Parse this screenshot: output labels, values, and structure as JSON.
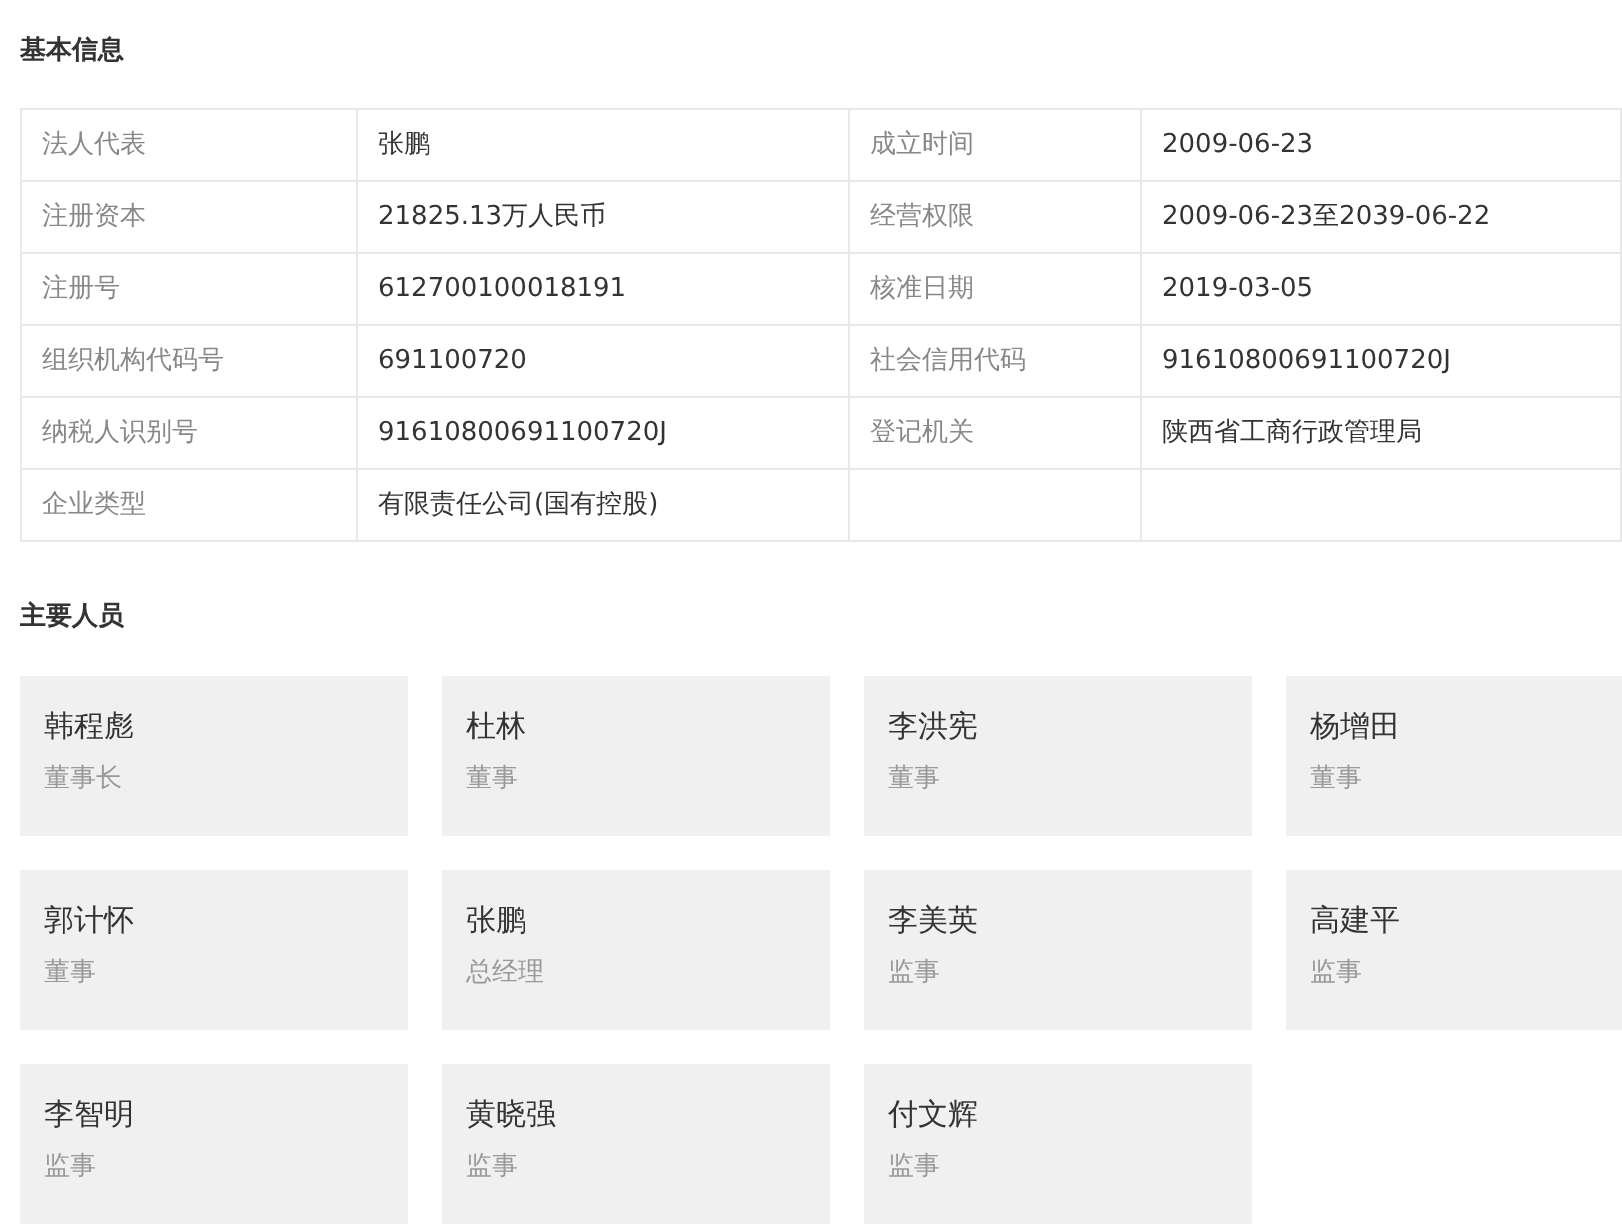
{
  "basic_info": {
    "title": "基本信息",
    "rows": [
      [
        {
          "label": "法人代表",
          "value": "张鹏"
        },
        {
          "label": "成立时间",
          "value": "2009-06-23"
        }
      ],
      [
        {
          "label": "注册资本",
          "value": "21825.13万人民币"
        },
        {
          "label": "经营权限",
          "value": "2009-06-23至2039-06-22"
        }
      ],
      [
        {
          "label": "注册号",
          "value": "612700100018191"
        },
        {
          "label": "核准日期",
          "value": "2019-03-05"
        }
      ],
      [
        {
          "label": "组织机构代码号",
          "value": "691100720"
        },
        {
          "label": "社会信用代码",
          "value": "91610800691100720J"
        }
      ],
      [
        {
          "label": "纳税人识别号",
          "value": "91610800691100720J"
        },
        {
          "label": "登记机关",
          "value": "陕西省工商行政管理局"
        }
      ],
      [
        {
          "label": "企业类型",
          "value": "有限责任公司(国有控股)"
        }
      ]
    ]
  },
  "key_people": {
    "title": "主要人员",
    "people": [
      {
        "name": "韩程彪",
        "role": "董事长"
      },
      {
        "name": "杜林",
        "role": "董事"
      },
      {
        "name": "李洪宪",
        "role": "董事"
      },
      {
        "name": "杨增田",
        "role": "董事"
      },
      {
        "name": "郭计怀",
        "role": "董事"
      },
      {
        "name": "张鹏",
        "role": "总经理"
      },
      {
        "name": "李美英",
        "role": "监事"
      },
      {
        "name": "高建平",
        "role": "监事"
      },
      {
        "name": "李智明",
        "role": "监事"
      },
      {
        "name": "黄晓强",
        "role": "监事"
      },
      {
        "name": "付文辉",
        "role": "监事"
      }
    ]
  }
}
